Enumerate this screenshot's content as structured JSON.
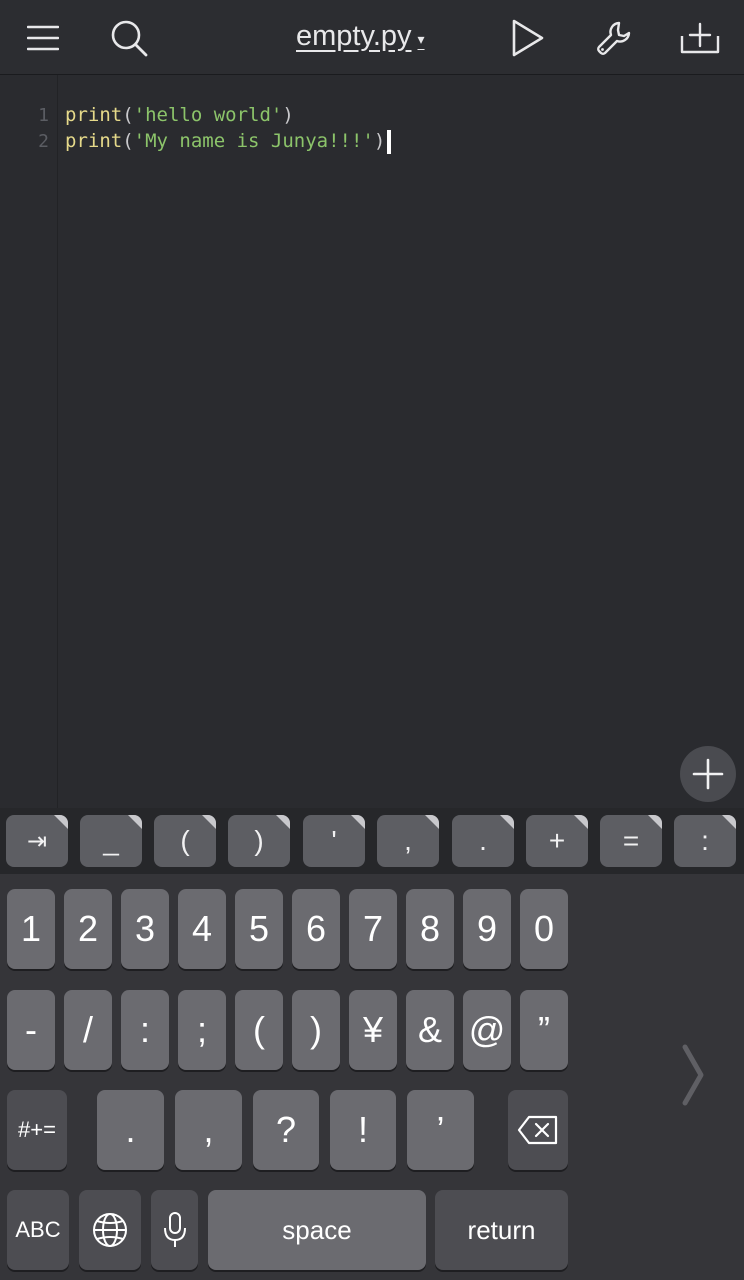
{
  "toolbar": {
    "file_name": "empty.py",
    "caret": "▾",
    "icons": [
      "menu-icon",
      "search-icon",
      "play-icon",
      "wrench-icon",
      "add-tab-icon"
    ]
  },
  "editor": {
    "line_numbers": [
      "1",
      "2"
    ],
    "lines": [
      {
        "func": "print",
        "open": "(",
        "string": "'hello world'",
        "close": ")"
      },
      {
        "func": "print",
        "open": "(",
        "string": "'My name is Junya!!!'",
        "close": ")"
      }
    ]
  },
  "accessory_keys": [
    "⇥",
    "_",
    "(",
    ")",
    "'",
    ",",
    ".",
    "+",
    "=",
    ":"
  ],
  "keyboard": {
    "row1": [
      "1",
      "2",
      "3",
      "4",
      "5",
      "6",
      "7",
      "8",
      "9",
      "0"
    ],
    "row2": [
      "-",
      "/",
      ":",
      ";",
      "(",
      ")",
      "¥",
      "&",
      "@",
      "”"
    ],
    "row3_mode": "#+=",
    "row3": [
      ".",
      ",",
      "?",
      "!",
      "’"
    ],
    "abc": "ABC",
    "space": "space",
    "return": "return"
  },
  "colors": {
    "editor_bg": "#2a2b2f",
    "keyword": "#e5d98a",
    "string": "#8cc46a",
    "line_number": "#5b5d63"
  }
}
